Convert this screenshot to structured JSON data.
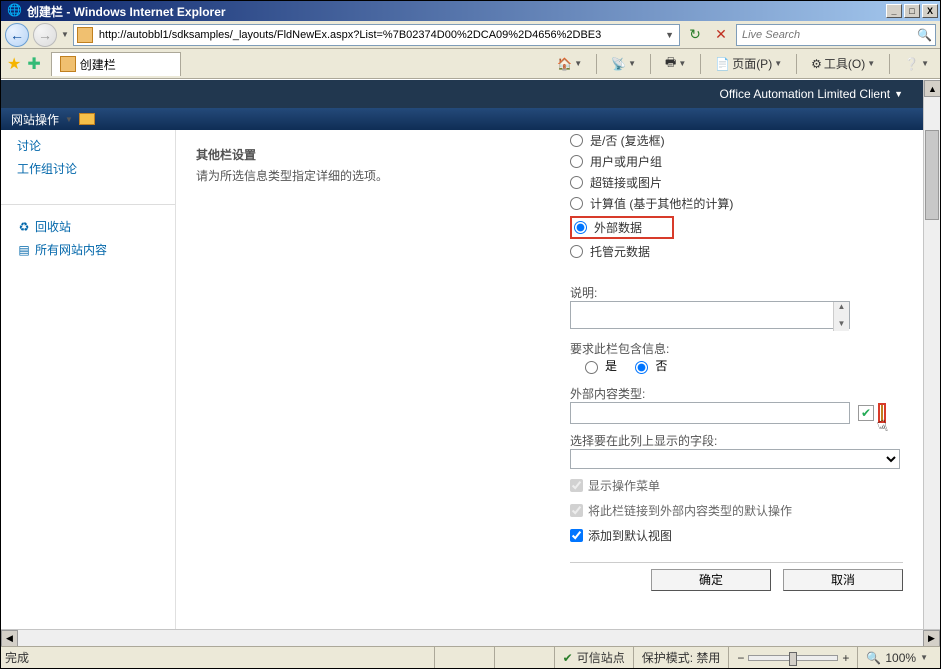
{
  "window": {
    "title": "创建栏 - Windows Internet Explorer"
  },
  "nav": {
    "url": "http://autobbl1/sdksamples/_layouts/FldNewEx.aspx?List=%7B02374D00%2DCA09%2D4656%2DBE3",
    "search_placeholder": "Live Search"
  },
  "tab": {
    "title": "创建栏"
  },
  "toolbar": {
    "page": "页面(P)",
    "tools": "工具(O)"
  },
  "sp": {
    "top_right": "Office Automation Limited Client",
    "site_actions": "网站操作"
  },
  "leftnav": {
    "discussion": "讨论",
    "team_discussion": "工作组讨论",
    "recycle": "回收站",
    "all_content": "所有网站内容"
  },
  "radios": {
    "yesno": "是/否 (复选框)",
    "person": "用户或用户组",
    "hyperlink": "超链接或图片",
    "calculated": "计算值 (基于其他栏的计算)",
    "external": "外部数据",
    "managed": "托管元数据"
  },
  "section": {
    "title": "其他栏设置",
    "desc": "请为所选信息类型指定详细的选项。"
  },
  "labels": {
    "description": "说明:",
    "require": "要求此栏包含信息:",
    "yes": "是",
    "no": "否",
    "ext_type": "外部内容类型:",
    "select_field": "选择要在此列上显示的字段:",
    "show_actions": "显示操作菜单",
    "link_default": "将此栏链接到外部内容类型的默认操作",
    "add_default_view": "添加到默认视图"
  },
  "values": {
    "description": "",
    "require": "no",
    "ext_type": "",
    "select_field": "",
    "show_actions": true,
    "link_default": true,
    "add_default_view": true
  },
  "buttons": {
    "ok": "确定",
    "cancel": "取消"
  },
  "status": {
    "done": "完成",
    "trusted": "可信站点",
    "protected": "保护模式: 禁用",
    "zoom": "100%"
  }
}
